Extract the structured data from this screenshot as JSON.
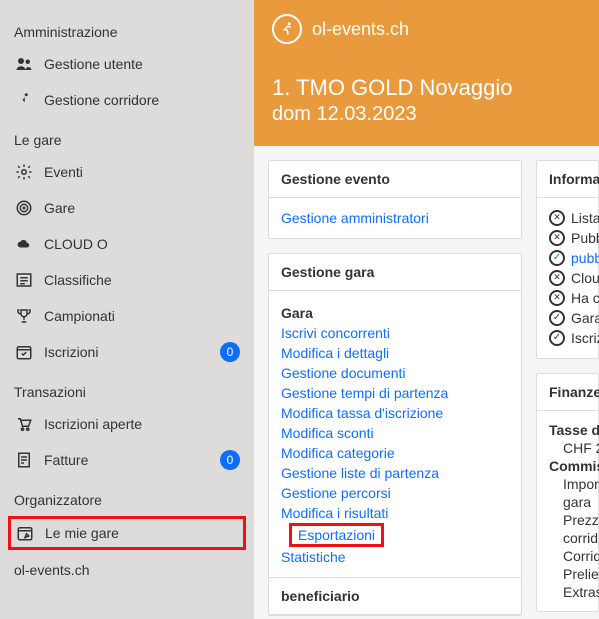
{
  "brand": {
    "name": "ol-events.ch"
  },
  "hero": {
    "title": "1. TMO GOLD Novaggio",
    "subtitle": "dom 12.03.2023"
  },
  "sidebar": {
    "sections": {
      "admin": {
        "label": "Amministrazione",
        "items": [
          {
            "label": "Gestione utente"
          },
          {
            "label": "Gestione corridore"
          }
        ]
      },
      "gare": {
        "label": "Le gare",
        "items": [
          {
            "label": "Eventi"
          },
          {
            "label": "Gare"
          },
          {
            "label": "CLOUD O"
          },
          {
            "label": "Classifiche"
          },
          {
            "label": "Campionati"
          },
          {
            "label": "Iscrizioni",
            "badge": "0"
          }
        ]
      },
      "transazioni": {
        "label": "Transazioni",
        "items": [
          {
            "label": "Iscrizioni aperte"
          },
          {
            "label": "Fatture",
            "badge": "0"
          }
        ]
      },
      "organizzatore": {
        "label": "Organizzatore",
        "items": [
          {
            "label": "Le mie gare"
          }
        ]
      }
    },
    "footer": "ol-events.ch"
  },
  "cards": {
    "gestione_evento": {
      "title": "Gestione evento",
      "links": {
        "admin": "Gestione amministratori"
      }
    },
    "gestione_gara": {
      "title": "Gestione gara",
      "gara_label": "Gara",
      "links": [
        "Iscrivi concorrenti",
        "Modifica i dettagli",
        "Gestione documenti",
        "Gestione tempi di partenza",
        "Modifica tassa d'iscrizione",
        "Modifica sconti",
        "Modifica categorie",
        "Gestione liste di partenza",
        "Gestione percorsi",
        "Modifica i risultati",
        "Esportazioni",
        "Statistiche"
      ],
      "beneficiario_label": "beneficiario"
    },
    "informazioni": {
      "title": "Informaz",
      "items": [
        {
          "icon": "x",
          "text": "Lista"
        },
        {
          "icon": "x",
          "text": "Pubb"
        },
        {
          "icon": "ok",
          "link": true,
          "text": "pubb"
        },
        {
          "icon": "x",
          "text": "Clou"
        },
        {
          "icon": "x",
          "text": "Ha c"
        },
        {
          "icon": "ok",
          "text": "Gara"
        },
        {
          "icon": "ok",
          "text": "Iscriz"
        }
      ]
    },
    "finanze": {
      "title": "Finanze",
      "heading": "Tasse di",
      "chf": "CHF 2",
      "commiss_label": "Commissi",
      "lines": [
        "Impor",
        "gara",
        "Prezzo",
        "corrid",
        "Corrid",
        "Preliev",
        "Extras"
      ]
    }
  }
}
